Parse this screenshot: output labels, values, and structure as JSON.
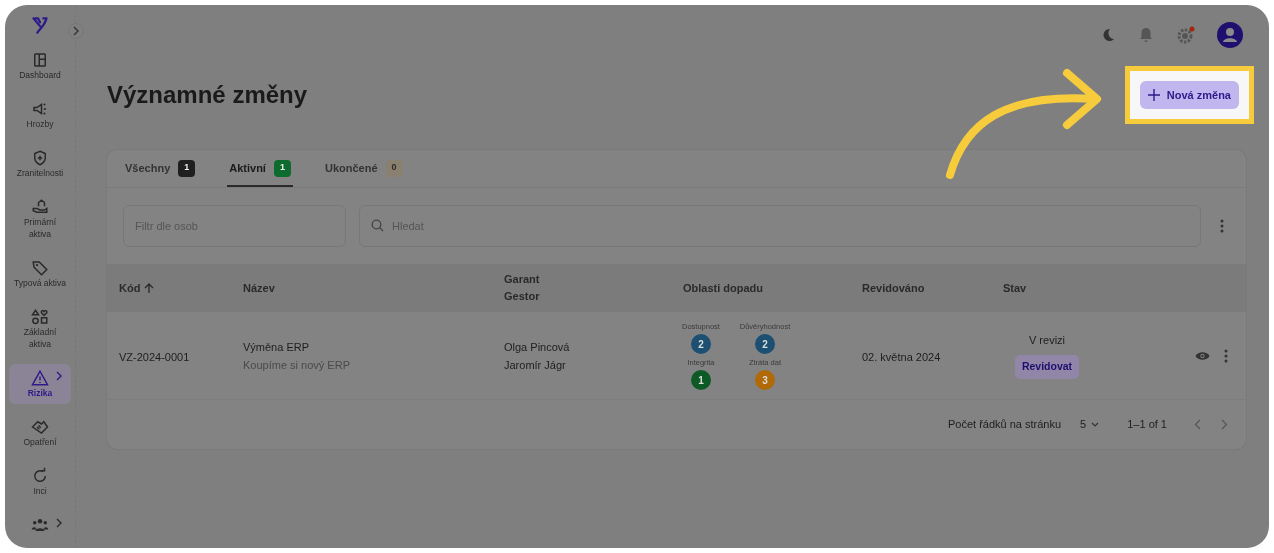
{
  "sidebar": {
    "items": [
      {
        "kind": "dashboard",
        "label": "Dashboard",
        "selected": false,
        "expandable": false
      },
      {
        "kind": "megaphone",
        "label": "Hrozby",
        "selected": false,
        "expandable": false
      },
      {
        "kind": "shield",
        "label": "Zranitelnosti",
        "selected": false,
        "expandable": false
      },
      {
        "kind": "hand",
        "label": "Primární aktiva",
        "selected": false,
        "expandable": false
      },
      {
        "kind": "tag",
        "label": "Typová aktiva",
        "selected": false,
        "expandable": false
      },
      {
        "kind": "shapes",
        "label": "Základní aktiva",
        "selected": false,
        "expandable": false
      },
      {
        "kind": "warning",
        "label": "Rizika",
        "selected": true,
        "expandable": true
      },
      {
        "kind": "handshake",
        "label": "Opatření",
        "selected": false,
        "expandable": false
      },
      {
        "kind": "refresh",
        "label": "Inci",
        "selected": false,
        "expandable": false
      },
      {
        "kind": "people",
        "selected": false,
        "expandable": true
      }
    ]
  },
  "page": {
    "title": "Významné změny",
    "new_button": "Nová změna"
  },
  "tabs": [
    {
      "label": "Všechny",
      "count": "1",
      "color": "#1f1f1f",
      "selected": false
    },
    {
      "label": "Aktivní",
      "count": "1",
      "color": "#0e6b2e",
      "selected": true
    },
    {
      "label": "Ukončené",
      "count": "0",
      "color": "#8a8070",
      "selected": false
    }
  ],
  "filters": {
    "person_placeholder": "Filtr dle osob",
    "search_placeholder": "Hledat"
  },
  "table": {
    "columns": [
      {
        "label": "Kód",
        "sorted": true
      },
      {
        "label": "Název"
      },
      {
        "label": "Garant",
        "label_2": "Gestor"
      },
      {
        "label": "Oblasti dopadu"
      },
      {
        "label": "Revidováno"
      },
      {
        "label": "Stav"
      }
    ],
    "rows": [
      {
        "code": "VZ-2024-0001",
        "name": "Výměna ERP",
        "description": "Koupíme si nový ERP",
        "garant": "Olga Pincová",
        "gestor": "Jaromír Jágr",
        "impacts": [
          {
            "label": "Dostupnost",
            "value": "2",
            "color": "#1d4f73"
          },
          {
            "label": "Důvěryhodnost",
            "value": "2",
            "color": "#1d4f73"
          },
          {
            "label": "Integrita",
            "value": "1",
            "color": "#0e5a26"
          },
          {
            "label": "Ztráta dat",
            "value": "3",
            "color": "#b06a08"
          }
        ],
        "revised": "02. května 2024",
        "status": "V revizi",
        "action": "Revidovat"
      }
    ]
  },
  "pagination": {
    "rows_label": "Počet řádků na stránku",
    "rows_per_page": "5",
    "range": "1–1 of 1"
  }
}
